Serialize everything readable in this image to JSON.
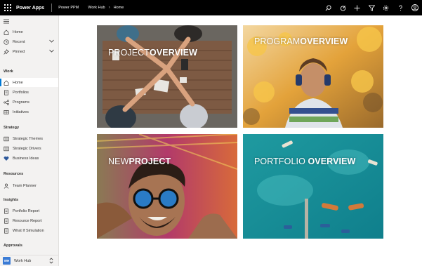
{
  "topbar": {
    "app_name": "Power Apps",
    "environment": "Power PPM",
    "breadcrumb": [
      "Work Hub",
      "Home"
    ],
    "icons": [
      "waffle-icon",
      "search-icon",
      "assistant-icon",
      "plus-icon",
      "filter-icon",
      "gear-icon",
      "help-icon",
      "account-icon"
    ]
  },
  "sidebar": {
    "top_items": [
      {
        "label": "Home",
        "icon": "home-icon"
      },
      {
        "label": "Recent",
        "icon": "clock-icon"
      },
      {
        "label": "Pinned",
        "icon": "pin-icon"
      }
    ],
    "groups": [
      {
        "title": "Work",
        "items": [
          {
            "label": "Home",
            "icon": "home-icon",
            "active": true
          },
          {
            "label": "Portfolios",
            "icon": "document-icon"
          },
          {
            "label": "Programs",
            "icon": "share-icon"
          },
          {
            "label": "Initiatives",
            "icon": "grid-icon"
          }
        ]
      },
      {
        "title": "Strategy",
        "items": [
          {
            "label": "Strategic Themes",
            "icon": "list-icon"
          },
          {
            "label": "Strategic Drivers",
            "icon": "list-icon"
          },
          {
            "label": "Business Ideas",
            "icon": "heart-icon"
          }
        ]
      },
      {
        "title": "Resources",
        "items": [
          {
            "label": "Team Planner",
            "icon": "person-icon"
          }
        ]
      },
      {
        "title": "Insights",
        "items": [
          {
            "label": "Portfolio Report",
            "icon": "report-icon"
          },
          {
            "label": "Resource Report",
            "icon": "report-icon"
          },
          {
            "label": "What If Simulation",
            "icon": "report-icon"
          }
        ]
      },
      {
        "title": "Approvals",
        "items": []
      }
    ],
    "area_switcher": {
      "badge": "WH",
      "label": "Work Hub"
    }
  },
  "tiles": [
    {
      "light": "PROJECT",
      "bold": "OVERVIEW"
    },
    {
      "light": "PROGRAM",
      "bold": "OVERVIEW"
    },
    {
      "light": "NEW",
      "bold": "PROJECT"
    },
    {
      "light": "PORTFOLIO ",
      "bold": "OVERVIEW"
    }
  ],
  "colors": {
    "accent": "#0078d4",
    "topbar": "#000000",
    "sidebar": "#f3f2f1"
  }
}
